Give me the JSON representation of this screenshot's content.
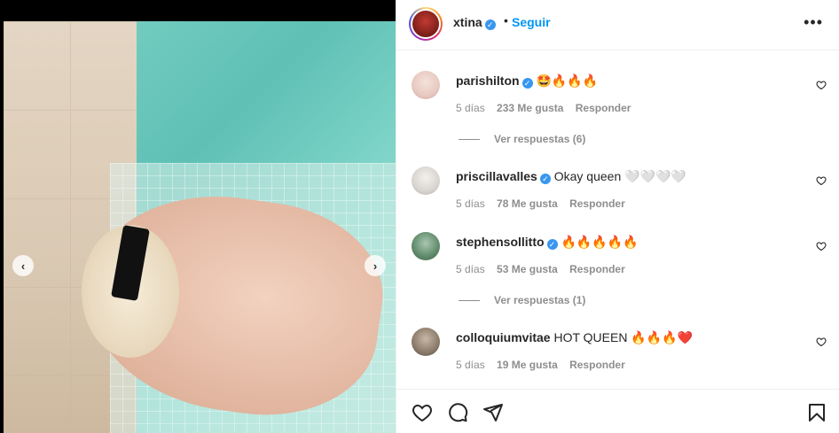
{
  "header": {
    "username": "xtina",
    "separator": "•",
    "follow_label": "Seguir",
    "more_icon": "more-horizontal-icon"
  },
  "media": {
    "prev_icon": "chevron-left-icon",
    "next_icon": "chevron-right-icon",
    "prev_glyph": "‹",
    "next_glyph": "›"
  },
  "comments": [
    {
      "username": "parishilton",
      "verified": true,
      "text": "🤩🔥🔥🔥",
      "time": "5 días",
      "likes": "233 Me gusta",
      "reply": "Responder",
      "view_replies": "Ver respuestas (6)",
      "avatar_color": "#e8c9c2"
    },
    {
      "username": "priscillavalles",
      "verified": true,
      "text": "Okay queen 🤍🤍🤍🤍",
      "time": "5 días",
      "likes": "78 Me gusta",
      "reply": "Responder",
      "avatar_color": "#d8d4cf"
    },
    {
      "username": "stephensollitto",
      "verified": true,
      "text": "🔥🔥🔥🔥🔥",
      "time": "5 días",
      "likes": "53 Me gusta",
      "reply": "Responder",
      "view_replies": "Ver respuestas (1)",
      "avatar_color": "#5f8a6a"
    },
    {
      "username": "colloquiumvitae",
      "verified": false,
      "text": "HOT QUEEN 🔥🔥🔥❤️",
      "time": "5 días",
      "likes": "19 Me gusta",
      "reply": "Responder",
      "avatar_color": "#8a7a6a"
    }
  ],
  "actions": {
    "like_icon": "heart-icon",
    "comment_icon": "comment-icon",
    "share_icon": "share-icon",
    "save_icon": "bookmark-icon"
  },
  "colors": {
    "link_blue": "#0095f6",
    "verified_blue": "#3897f0",
    "muted": "#8e8e8e"
  }
}
